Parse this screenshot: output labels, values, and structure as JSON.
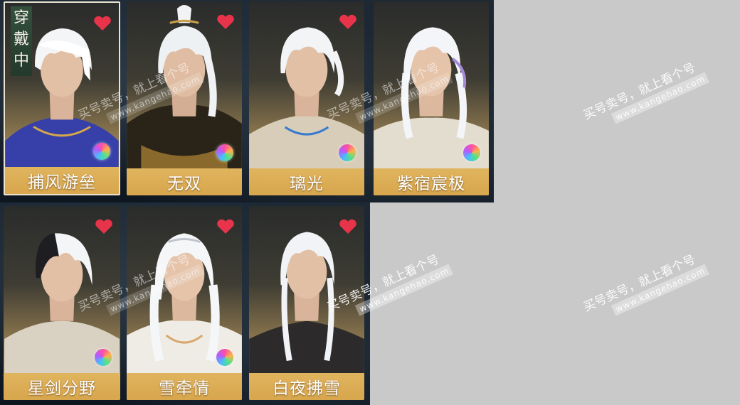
{
  "selected_badge": [
    "穿",
    "戴",
    "中"
  ],
  "hairstyles": [
    {
      "name": "捕风游垒"
    },
    {
      "name": "无双"
    },
    {
      "name": "璃光"
    },
    {
      "name": "紫宿宸极"
    },
    {
      "name": "星剑分野"
    },
    {
      "name": "雪牵情"
    },
    {
      "name": "白夜拂雪"
    }
  ],
  "watermark": {
    "text": "买号卖号，就上看个号",
    "url": "www.kangehao.com"
  },
  "colors": {
    "heart": "#e8344a",
    "nameplate": "#d9a84f",
    "selected_border": "#e9e3d0"
  }
}
